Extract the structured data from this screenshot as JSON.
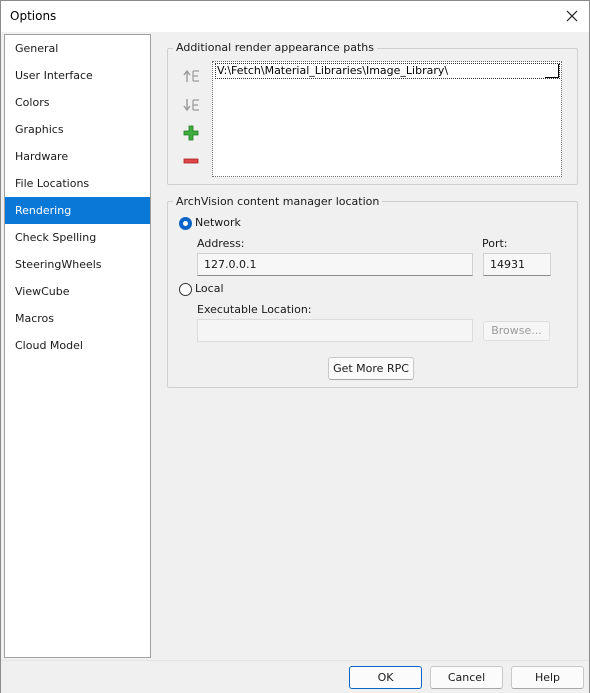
{
  "window": {
    "title": "Options"
  },
  "nav": {
    "items": [
      {
        "label": "General"
      },
      {
        "label": "User Interface"
      },
      {
        "label": "Colors"
      },
      {
        "label": "Graphics"
      },
      {
        "label": "Hardware"
      },
      {
        "label": "File Locations"
      },
      {
        "label": "Rendering",
        "selected": true
      },
      {
        "label": "Check Spelling"
      },
      {
        "label": "SteeringWheels"
      },
      {
        "label": "ViewCube"
      },
      {
        "label": "Macros"
      },
      {
        "label": "Cloud Model"
      }
    ]
  },
  "render_paths": {
    "group_label": "Additional render appearance paths",
    "paths": [
      "V:\\Fetch\\Material_Libraries\\Image_Library\\"
    ],
    "tools": [
      "move-up-icon",
      "move-down-icon",
      "add-icon",
      "remove-icon"
    ]
  },
  "archvision": {
    "group_label": "ArchVision content manager location",
    "network": {
      "label": "Network",
      "selected": true,
      "address_label": "Address:",
      "address_value": "127.0.0.1",
      "port_label": "Port:",
      "port_value": "14931"
    },
    "local": {
      "label": "Local",
      "selected": false,
      "exec_label": "Executable Location:",
      "exec_value": "",
      "browse_label": "Browse..."
    },
    "get_more_label": "Get More RPC"
  },
  "footer": {
    "ok_label": "OK",
    "cancel_label": "Cancel",
    "help_label": "Help"
  },
  "colors": {
    "selection": "#0a78d7",
    "add_green": "#2e9e2e",
    "remove_red": "#d93b3b"
  }
}
